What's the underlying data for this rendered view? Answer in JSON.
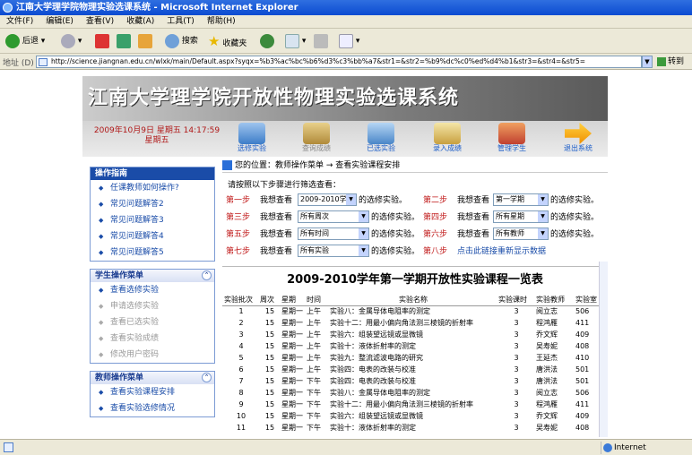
{
  "window": {
    "title": "江南大学理学院物理实验选课系统 - Microsoft Internet Explorer"
  },
  "menu": [
    "文件(F)",
    "编辑(E)",
    "查看(V)",
    "收藏(A)",
    "工具(T)",
    "帮助(H)"
  ],
  "toolbar": {
    "back": "后退",
    "search": "搜索",
    "favorites": "收藏夹"
  },
  "address": {
    "label": "地址 (D)",
    "url": "http://science.jiangnan.edu.cn/wlxk/main/Default.aspx?syqx=%b3%ac%bc%b6%d3%c3%bb%a7&str1=&str2=%b9%dc%c0%ed%d4%b1&str3=&str4=&str5=",
    "go": "转到"
  },
  "banner": {
    "title": "江南大学理学院开放性物理实验选课系统"
  },
  "nav": {
    "date": "2009年10月9日 星期五 14:17:59",
    "weekday": "星期五",
    "buttons": [
      {
        "label": "选修实验"
      },
      {
        "label": "查询成绩"
      },
      {
        "label": "已选实验"
      },
      {
        "label": "录入成绩"
      },
      {
        "label": "管理学生"
      },
      {
        "label": "退出系统"
      }
    ]
  },
  "sidebar": {
    "guide": {
      "title": "操作指南",
      "items": [
        "任课教师如何操作?",
        "常见问题解答2",
        "常见问题解答3",
        "常见问题解答4",
        "常见问题解答5"
      ]
    },
    "student": {
      "title": "学生操作菜单",
      "items": [
        "查看选修实验",
        "申请选修实验",
        "查看已选实验",
        "查看实验成绩",
        "修改用户密码"
      ]
    },
    "teacher": {
      "title": "教师操作菜单",
      "items": [
        "查看实验课程安排",
        "查看实验选修情况"
      ]
    }
  },
  "main": {
    "breadcrumb": "您的位置：教师操作菜单 → 查看实验课程安排",
    "instruction": "请按照以下步骤进行筛选查看：",
    "steps": {
      "s1": {
        "label": "第一步",
        "pre": "我想查看",
        "value": "2009-2010学年",
        "post": "的选修实验。"
      },
      "s2": {
        "label": "第二步",
        "pre": "我想查看",
        "value": "第一学期",
        "post": "的选修实验。"
      },
      "s3": {
        "label": "第三步",
        "pre": "我想查看",
        "value": "所有周次",
        "post": "的选修实验。"
      },
      "s4": {
        "label": "第四步",
        "pre": "我想查看",
        "value": "所有星期",
        "post": "的选修实验。"
      },
      "s5": {
        "label": "第五步",
        "pre": "我想查看",
        "value": "所有时间",
        "post": "的选修实验。"
      },
      "s6": {
        "label": "第六步",
        "pre": "我想查看",
        "value": "所有教师",
        "post": "的选修实验。"
      },
      "s7": {
        "label": "第七步",
        "pre": "我想查看",
        "value": "所有实验",
        "post": "的选修实验。"
      },
      "s8": {
        "label": "第八步",
        "link": "点击此链接重新显示数据"
      }
    },
    "table": {
      "title": "2009-2010学年第一学期开放性实验课程一览表",
      "headers": [
        "实验批次",
        "周次",
        "星期",
        "时间",
        "实验名称",
        "实验课时",
        "实验教师",
        "实验室"
      ],
      "rows": [
        [
          "1",
          "15",
          "星期一",
          "上午",
          "实验八：金属导体电阻率的测定",
          "3",
          "阅立志",
          "506"
        ],
        [
          "2",
          "15",
          "星期一",
          "上午",
          "实验十二：用最小偏向角法测三棱镜的折射率",
          "3",
          "程鸿雁",
          "411"
        ],
        [
          "3",
          "15",
          "星期一",
          "上午",
          "实验六：组装望远镜或显微镜",
          "3",
          "乔文辉",
          "409"
        ],
        [
          "4",
          "15",
          "星期一",
          "上午",
          "实验十：液体折射率的测定",
          "3",
          "吴寿妮",
          "408"
        ],
        [
          "5",
          "15",
          "星期一",
          "上午",
          "实验九：整流滤波电路的研究",
          "3",
          "王延杰",
          "410"
        ],
        [
          "6",
          "15",
          "星期一",
          "上午",
          "实验四：电表的改装与校准",
          "3",
          "唐洪法",
          "501"
        ],
        [
          "7",
          "15",
          "星期一",
          "下午",
          "实验四：电表的改装与校准",
          "3",
          "唐洪法",
          "501"
        ],
        [
          "8",
          "15",
          "星期一",
          "下午",
          "实验八：金属导体电阻率的测定",
          "3",
          "阅立志",
          "506"
        ],
        [
          "9",
          "15",
          "星期一",
          "下午",
          "实验十二：用最小偏向角法测三棱镜的折射率",
          "3",
          "程鸿雁",
          "411"
        ],
        [
          "10",
          "15",
          "星期一",
          "下午",
          "实验六：组装望远镜或显微镜",
          "3",
          "乔文辉",
          "409"
        ],
        [
          "11",
          "15",
          "星期一",
          "下午",
          "实验十：液体折射率的测定",
          "3",
          "吴寿妮",
          "408"
        ]
      ]
    }
  },
  "status": {
    "zone": "Internet"
  }
}
